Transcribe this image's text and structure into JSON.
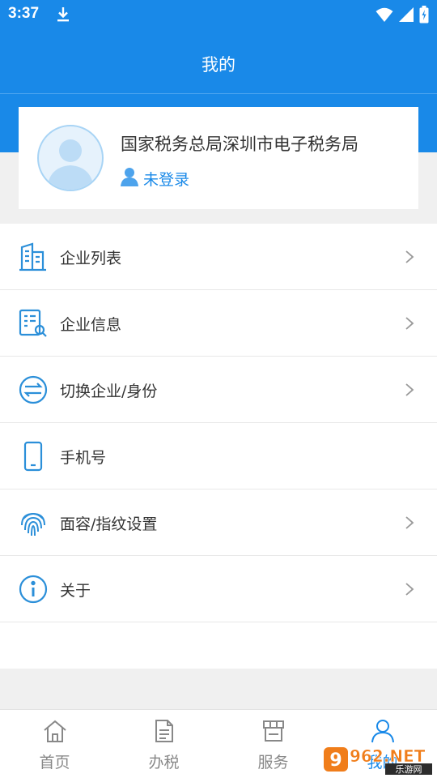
{
  "status_bar": {
    "time": "3:37"
  },
  "header": {
    "title": "我的"
  },
  "profile": {
    "organization": "国家税务总局深圳市电子税务局",
    "login_status": "未登录"
  },
  "menu": {
    "items": [
      {
        "label": "企业列表",
        "icon": "building-icon",
        "has_chevron": true
      },
      {
        "label": "企业信息",
        "icon": "document-search-icon",
        "has_chevron": true
      },
      {
        "label": "切换企业/身份",
        "icon": "switch-icon",
        "has_chevron": true
      },
      {
        "label": "手机号",
        "icon": "phone-icon",
        "has_chevron": false
      },
      {
        "label": "面容/指纹设置",
        "icon": "fingerprint-icon",
        "has_chevron": true
      },
      {
        "label": "关于",
        "icon": "info-icon",
        "has_chevron": true
      }
    ]
  },
  "tabbar": {
    "tabs": [
      {
        "label": "首页",
        "icon": "home-icon"
      },
      {
        "label": "办税",
        "icon": "tax-document-icon"
      },
      {
        "label": "服务",
        "icon": "store-icon"
      },
      {
        "label": "我的",
        "icon": "person-icon",
        "active": true
      }
    ]
  },
  "watermark": {
    "brand": "962.NET",
    "subtitle": "乐游网"
  },
  "colors": {
    "primary": "#1989e8",
    "icon_blue": "#2b8fd9",
    "text": "#333333",
    "muted": "#888888"
  }
}
